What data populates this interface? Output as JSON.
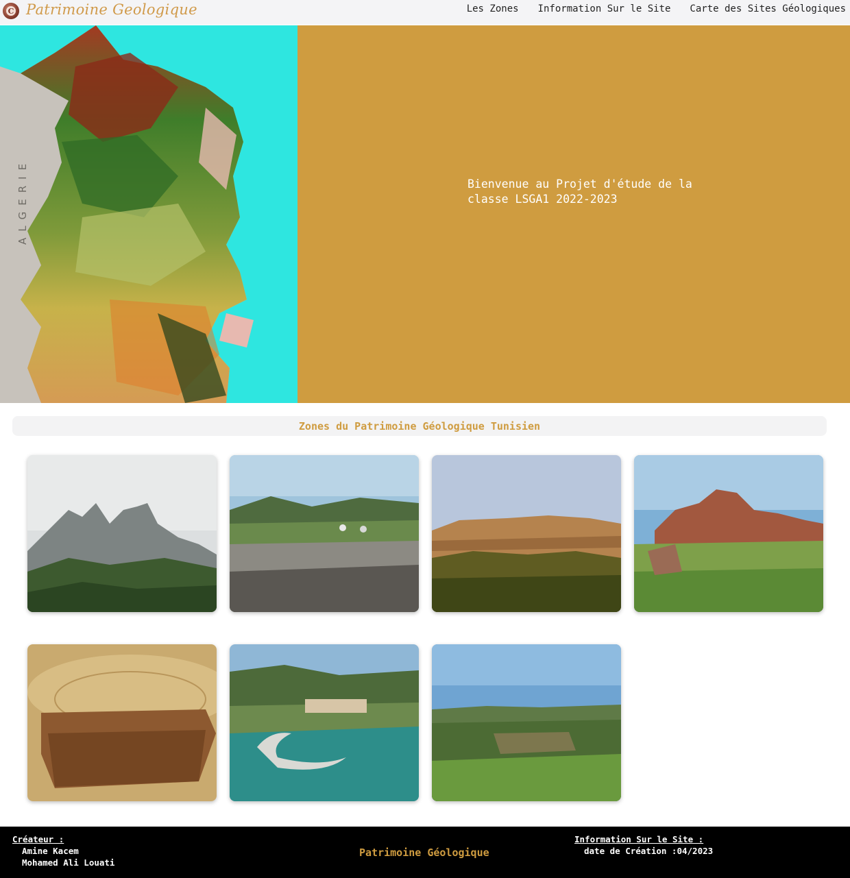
{
  "header": {
    "brand": "Patrimoine Geologique",
    "nav": [
      "Les Zones",
      "Information Sur le Site",
      "Carte des Sites Géologiques"
    ]
  },
  "hero": {
    "map_label": "ALGERIE",
    "welcome_line1": "Bienvenue au Projet d'étude de la",
    "welcome_line2": "classe LSGA1 2022-2023"
  },
  "zones": {
    "title": "Zones du Patrimoine Géologique Tunisien",
    "cards": [
      {
        "scene": "rocky-peaks-in-mist"
      },
      {
        "scene": "rocky-plateau-with-cars"
      },
      {
        "scene": "sunlit-cliff-above-forest"
      },
      {
        "scene": "red-rock-formations"
      },
      {
        "scene": "layered-rock-mesa"
      },
      {
        "scene": "coastal-bay-with-breakwater"
      },
      {
        "scene": "green-valley-ruins"
      }
    ]
  },
  "footer": {
    "creator_label": "Créateur :",
    "creators": [
      "Amine Kacem",
      "Mohamed Ali Louati"
    ],
    "center_title": "Patrimoine Géologique",
    "info_label": "Information Sur le Site :",
    "creation_date": "date de Création :04/2023"
  },
  "colors": {
    "accent": "#cf9c40",
    "header_bg": "#f4f4f6",
    "footer_bg": "#000000",
    "sea": "#2ee6e0"
  }
}
